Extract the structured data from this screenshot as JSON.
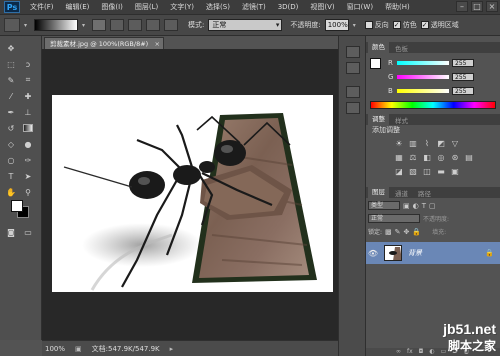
{
  "app": {
    "logo": "Ps"
  },
  "menu": [
    "文件(F)",
    "编辑(E)",
    "图像(I)",
    "图层(L)",
    "文字(Y)",
    "选择(S)",
    "滤镜(T)",
    "3D(D)",
    "视图(V)",
    "窗口(W)",
    "帮助(H)"
  ],
  "window_controls": [
    "–",
    "□",
    "×"
  ],
  "options": {
    "mode_label": "模式:",
    "mode_value": "正常",
    "opacity_label": "不透明度:",
    "opacity_value": "100%",
    "reverse_label": "反向",
    "dither_label": "仿色",
    "transparency_label": "透明区域"
  },
  "document": {
    "tab_title": "剪裁素材.jpg @ 100%(RGB/8#)",
    "tab_close": "×",
    "zoom": "100%",
    "info": "文档:547.9K/547.9K"
  },
  "color_panel": {
    "tabs": [
      "颜色",
      "色板"
    ],
    "channels": [
      {
        "label": "R",
        "value": "255",
        "color": "#ff4040"
      },
      {
        "label": "G",
        "value": "255",
        "color": "#40ff40"
      },
      {
        "label": "B",
        "value": "255",
        "color": "#4060ff"
      }
    ]
  },
  "adjustments_panel": {
    "tabs": [
      "调整",
      "样式"
    ],
    "title": "添加调整"
  },
  "layers_panel": {
    "tabs": [
      "图层",
      "通道",
      "路径"
    ],
    "kind_filter": "类型",
    "blend_mode": "正常",
    "opacity_label": "不透明度:",
    "lock_label": "锁定:",
    "fill_label": "填充:",
    "layer_name": "背景"
  },
  "watermark": {
    "site": "jb51.net",
    "name": "脚本之家"
  },
  "colors": {
    "accent": "#6a87b6",
    "frame": "#22301c",
    "bark": "#7b6052"
  }
}
